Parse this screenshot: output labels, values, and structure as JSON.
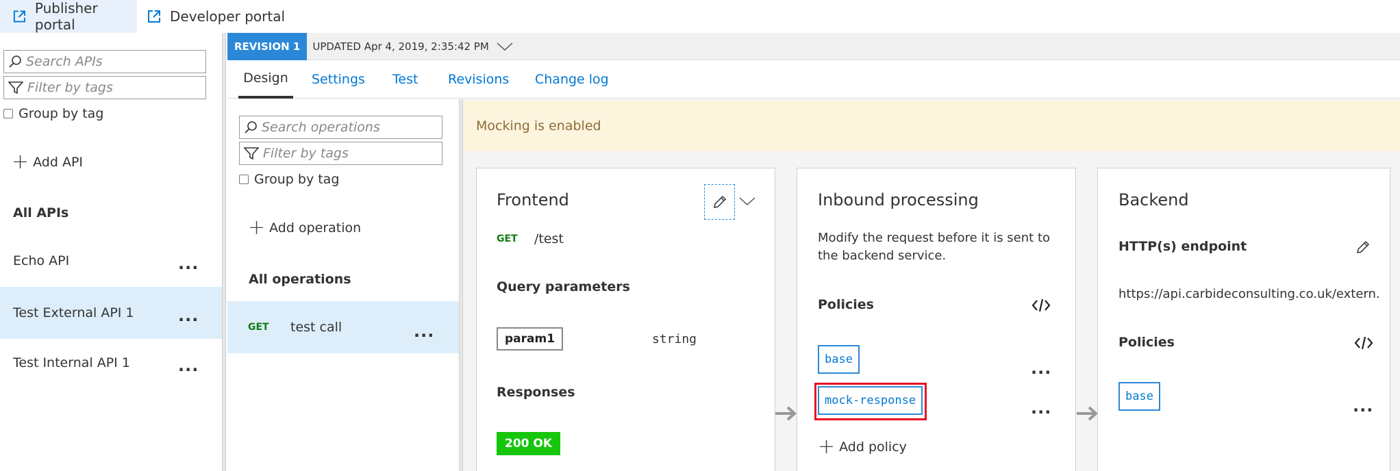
{
  "topbar": {
    "publisher_portal": "Publisher portal",
    "developer_portal": "Developer portal"
  },
  "api_sidebar": {
    "search_placeholder": "Search APIs",
    "filter_placeholder": "Filter by tags",
    "group_by_tag": "Group by tag",
    "add_api": "Add API",
    "all_apis": "All APIs",
    "items": [
      {
        "label": "Echo API",
        "selected": false
      },
      {
        "label": "Test External API 1",
        "selected": true
      },
      {
        "label": "Test Internal API 1",
        "selected": false
      }
    ],
    "more": "..."
  },
  "revision": {
    "badge": "REVISION 1",
    "updated": "UPDATED Apr 4, 2019, 2:35:42 PM"
  },
  "tabs": [
    "Design",
    "Settings",
    "Test",
    "Revisions",
    "Change log"
  ],
  "operations": {
    "search_placeholder": "Search operations",
    "filter_placeholder": "Filter by tags",
    "group_by_tag": "Group by tag",
    "add_operation": "Add operation",
    "all_operations": "All operations",
    "items": [
      {
        "method": "GET",
        "name": "test call",
        "selected": true
      }
    ],
    "more": "..."
  },
  "banner": {
    "text": "Mocking is enabled"
  },
  "frontend": {
    "title": "Frontend",
    "method": "GET",
    "path": "/test",
    "query_params_label": "Query parameters",
    "param_name": "param1",
    "param_type": "string",
    "responses_label": "Responses",
    "response_badge": "200 OK"
  },
  "inbound": {
    "title": "Inbound processing",
    "description_line1": "Modify the request before it is sent to",
    "description_line2": "the backend service.",
    "policies_label": "Policies",
    "policies": [
      "base",
      "mock-response"
    ],
    "add_policy": "Add policy",
    "more": "..."
  },
  "backend": {
    "title": "Backend",
    "endpoint_label": "HTTP(s) endpoint",
    "endpoint_url": "https://api.carbideconsulting.co.uk/extern...",
    "policies_label": "Policies",
    "policies": [
      "base"
    ],
    "more": "..."
  },
  "colors": {
    "accent": "#0078d4",
    "badge_blue": "#2b88d8",
    "get_green": "#107c10",
    "ok_green": "#16c60c",
    "highlight_red": "#e81123",
    "banner_bg": "#fdf4dd",
    "selected_bg": "#ddeefa"
  },
  "icons": {
    "portal": "external-link-icon",
    "search": "search-icon",
    "filter": "filter-icon",
    "add": "plus-icon",
    "edit": "pencil-icon",
    "expand": "chevron-down-icon",
    "code": "code-icon",
    "more": "more-icon",
    "flow": "arrow-right-icon"
  }
}
